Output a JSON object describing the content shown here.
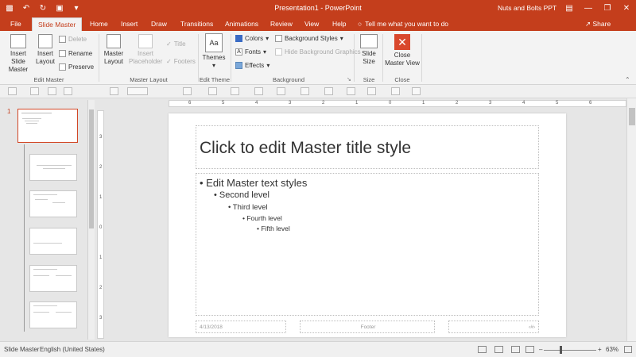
{
  "app": {
    "doc_title": "Presentation1  -  PowerPoint",
    "user": "Nuts and Bolts PPT",
    "accent": "#c43e1c"
  },
  "tabs": [
    {
      "label": "File"
    },
    {
      "label": "Slide Master"
    },
    {
      "label": "Home"
    },
    {
      "label": "Insert"
    },
    {
      "label": "Draw"
    },
    {
      "label": "Transitions"
    },
    {
      "label": "Animations"
    },
    {
      "label": "Review"
    },
    {
      "label": "View"
    },
    {
      "label": "Help"
    }
  ],
  "tellme": "Tell me what you want to do",
  "share": "Share",
  "ribbon": {
    "edit_master": {
      "insert_slide_master_1": "Insert Slide",
      "insert_slide_master_2": "Master",
      "insert_layout_1": "Insert",
      "insert_layout_2": "Layout",
      "delete": "Delete",
      "rename": "Rename",
      "preserve": "Preserve",
      "label": "Edit Master"
    },
    "master_layout": {
      "master_layout_1": "Master",
      "master_layout_2": "Layout",
      "insert_placeholder_1": "Insert",
      "insert_placeholder_2": "Placeholder",
      "title": "Title",
      "footers": "Footers",
      "label": "Master Layout"
    },
    "edit_theme": {
      "themes": "Themes",
      "label": "Edit Theme"
    },
    "background": {
      "colors": "Colors",
      "fonts": "Fonts",
      "effects": "Effects",
      "background_styles": "Background Styles",
      "hide_background_graphics": "Hide Background Graphics",
      "label": "Background"
    },
    "size": {
      "slide_size_1": "Slide",
      "slide_size_2": "Size",
      "label": "Size"
    },
    "close": {
      "close_1": "Close",
      "close_2": "Master View",
      "label": "Close"
    }
  },
  "thumbnails": {
    "master_number": "1"
  },
  "slide": {
    "title": "Click to edit Master title style",
    "levels": [
      "Edit Master text styles",
      "Second level",
      "Third level",
      "Fourth level",
      "Fifth level"
    ],
    "date": "4/13/2018",
    "footer": "Footer",
    "number": "‹#›"
  },
  "ruler": {
    "h_ticks": [
      "6",
      "5",
      "4",
      "3",
      "2",
      "1",
      "0",
      "1",
      "2",
      "3",
      "4",
      "5",
      "6"
    ],
    "v_ticks": [
      "3",
      "2",
      "1",
      "0",
      "1",
      "2",
      "3"
    ]
  },
  "status": {
    "view": "Slide Master",
    "language": "English (United States)",
    "zoom": "63%"
  }
}
